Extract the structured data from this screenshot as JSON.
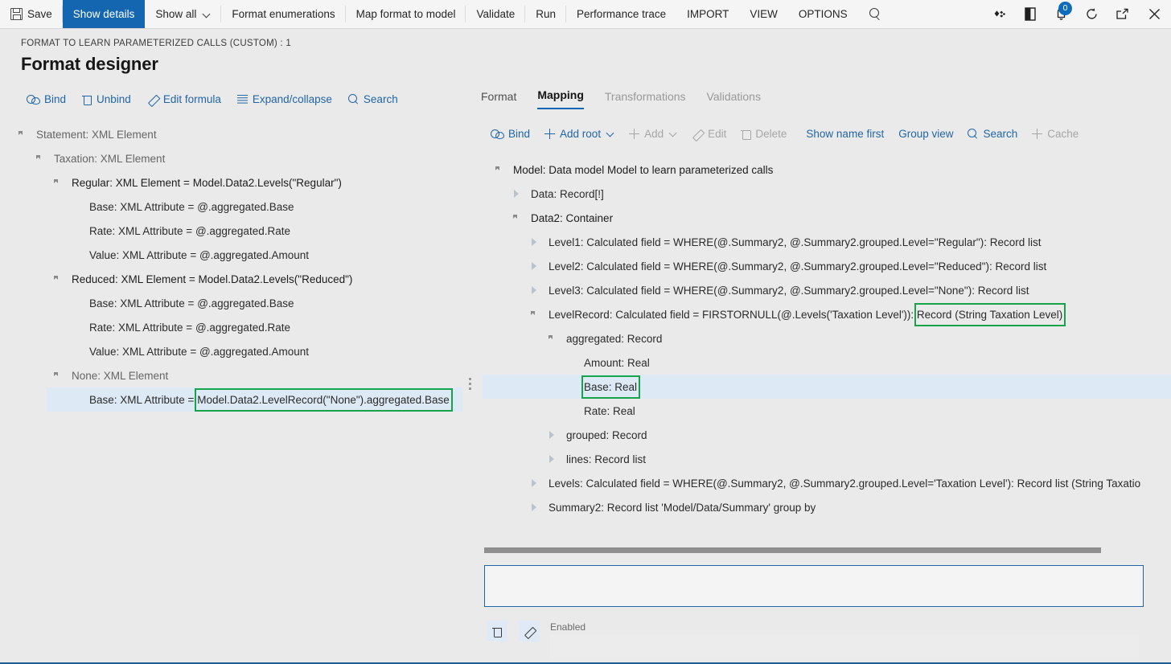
{
  "commandbar": {
    "items": [
      {
        "label": "Save",
        "icon": "save-icon",
        "state": "normal",
        "separator": true
      },
      {
        "label": "Show details",
        "icon": null,
        "state": "active",
        "separator": false
      },
      {
        "label": "Show all",
        "icon": null,
        "state": "normal",
        "caret": true,
        "separator": true
      },
      {
        "label": "Format enumerations",
        "icon": null,
        "state": "normal",
        "separator": true
      },
      {
        "label": "Map format to model",
        "icon": null,
        "state": "normal",
        "separator": true
      },
      {
        "label": "Validate",
        "icon": null,
        "state": "normal",
        "separator": true
      },
      {
        "label": "Run",
        "icon": null,
        "state": "normal",
        "separator": true
      },
      {
        "label": "Performance trace",
        "icon": null,
        "state": "normal",
        "separator": false
      },
      {
        "label": "IMPORT",
        "icon": null,
        "state": "normal",
        "separator": false
      },
      {
        "label": "VIEW",
        "icon": null,
        "state": "normal",
        "separator": false
      },
      {
        "label": "OPTIONS",
        "icon": null,
        "state": "normal",
        "separator": false
      }
    ],
    "search_icon": "search-icon",
    "right_icons": [
      {
        "name": "diamond-settings-icon",
        "glyph": "❖"
      },
      {
        "name": "office-app-icon",
        "glyph": "◗"
      },
      {
        "name": "notifications-icon",
        "glyph": "◖",
        "badge": "0"
      },
      {
        "name": "refresh-icon",
        "glyph": "↻"
      },
      {
        "name": "popout-icon",
        "glyph": "↗"
      },
      {
        "name": "close-icon",
        "glyph": "✕"
      }
    ]
  },
  "header": {
    "breadcrumb": "FORMAT TO LEARN PARAMETERIZED CALLS (CUSTOM) : 1",
    "title": "Format designer"
  },
  "format_toolbar": {
    "items": [
      {
        "label": "Bind",
        "icon": "bind-icon",
        "disabled": false
      },
      {
        "label": "Unbind",
        "icon": "trash-icon",
        "disabled": false
      },
      {
        "label": "Edit formula",
        "icon": "pencil-icon",
        "disabled": false
      },
      {
        "label": "Expand/collapse",
        "icon": "lines-icon",
        "disabled": false
      },
      {
        "label": "Search",
        "icon": "search-icon",
        "disabled": false
      }
    ]
  },
  "tabs": [
    {
      "label": "Format",
      "selected": false,
      "muted": false
    },
    {
      "label": "Mapping",
      "selected": true,
      "muted": false
    },
    {
      "label": "Transformations",
      "selected": false,
      "muted": true
    },
    {
      "label": "Validations",
      "selected": false,
      "muted": true
    }
  ],
  "mapping_toolbar": {
    "items": [
      {
        "label": "Bind",
        "icon": "bind-icon",
        "disabled": false,
        "caret": false
      },
      {
        "label": "Add root",
        "icon": "plus-icon",
        "disabled": false,
        "caret": true
      },
      {
        "label": "Add",
        "icon": "plus-icon",
        "disabled": true,
        "caret": true
      },
      {
        "label": "Edit",
        "icon": "pencil-icon",
        "disabled": true,
        "caret": false
      },
      {
        "label": "Delete",
        "icon": "trash-icon",
        "disabled": true,
        "caret": false
      },
      {
        "label": "Show name first",
        "icon": null,
        "disabled": false,
        "caret": false
      },
      {
        "label": "Group view",
        "icon": null,
        "disabled": false,
        "caret": false
      },
      {
        "label": "Search",
        "icon": "search-icon",
        "disabled": false,
        "caret": false
      },
      {
        "label": "Cache",
        "icon": "plus-icon",
        "disabled": true,
        "caret": false
      }
    ]
  },
  "format_tree": [
    {
      "text": "Statement: XML Element",
      "depth": 0,
      "twisty": "expanded",
      "tone": "dim",
      "selected": false,
      "highlight": null
    },
    {
      "text": "Taxation: XML Element",
      "depth": 1,
      "twisty": "expanded",
      "tone": "dim",
      "selected": false,
      "highlight": null
    },
    {
      "text": "Regular: XML Element = Model.Data2.Levels(\"Regular\")",
      "depth": 2,
      "twisty": "expanded",
      "tone": "strong",
      "selected": false,
      "highlight": null
    },
    {
      "text": "Base: XML Attribute = @.aggregated.Base",
      "depth": 3,
      "twisty": "none",
      "tone": "norm",
      "selected": false,
      "highlight": null
    },
    {
      "text": "Rate: XML Attribute = @.aggregated.Rate",
      "depth": 3,
      "twisty": "none",
      "tone": "norm",
      "selected": false,
      "highlight": null
    },
    {
      "text": "Value: XML Attribute = @.aggregated.Amount",
      "depth": 3,
      "twisty": "none",
      "tone": "norm",
      "selected": false,
      "highlight": null
    },
    {
      "text": "Reduced: XML Element = Model.Data2.Levels(\"Reduced\")",
      "depth": 2,
      "twisty": "expanded",
      "tone": "strong",
      "selected": false,
      "highlight": null
    },
    {
      "text": "Base: XML Attribute = @.aggregated.Base",
      "depth": 3,
      "twisty": "none",
      "tone": "norm",
      "selected": false,
      "highlight": null
    },
    {
      "text": "Rate: XML Attribute = @.aggregated.Rate",
      "depth": 3,
      "twisty": "none",
      "tone": "norm",
      "selected": false,
      "highlight": null
    },
    {
      "text": "Value: XML Attribute = @.aggregated.Amount",
      "depth": 3,
      "twisty": "none",
      "tone": "norm",
      "selected": false,
      "highlight": null
    },
    {
      "text": "None: XML Element",
      "depth": 2,
      "twisty": "expanded",
      "tone": "dim",
      "selected": false,
      "highlight": null
    },
    {
      "text": "Base: XML Attribute = Model.Data2.LevelRecord(\"None\").aggregated.Base",
      "depth": 3,
      "twisty": "none",
      "tone": "norm",
      "selected": true,
      "highlight": "Model.Data2.LevelRecord(\"None\").aggregated.Base"
    }
  ],
  "mapping_tree": [
    {
      "text": "Model: Data model Model to learn parameterized calls",
      "depth": 0,
      "twisty": "expanded",
      "tone": "strong",
      "selected": false,
      "highlight": null
    },
    {
      "text": "Data: Record[!]",
      "depth": 1,
      "twisty": "collapsed",
      "tone": "norm",
      "selected": false,
      "highlight": null
    },
    {
      "text": "Data2: Container",
      "depth": 1,
      "twisty": "expanded",
      "tone": "strong",
      "selected": false,
      "highlight": null
    },
    {
      "text": "Level1: Calculated field = WHERE(@.Summary2, @.Summary2.grouped.Level=\"Regular\"): Record list",
      "depth": 2,
      "twisty": "collapsed",
      "tone": "norm",
      "selected": false,
      "highlight": null
    },
    {
      "text": "Level2: Calculated field = WHERE(@.Summary2, @.Summary2.grouped.Level=\"Reduced\"): Record list",
      "depth": 2,
      "twisty": "collapsed",
      "tone": "norm",
      "selected": false,
      "highlight": null
    },
    {
      "text": "Level3: Calculated field = WHERE(@.Summary2, @.Summary2.grouped.Level=\"None\"): Record list",
      "depth": 2,
      "twisty": "collapsed",
      "tone": "norm",
      "selected": false,
      "highlight": null
    },
    {
      "text": "LevelRecord: Calculated field = FIRSTORNULL(@.Levels('Taxation Level')): Record (String Taxation Level)",
      "depth": 2,
      "twisty": "expanded",
      "tone": "norm",
      "selected": false,
      "highlight": "Record (String Taxation Level)"
    },
    {
      "text": "aggregated: Record",
      "depth": 3,
      "twisty": "expanded",
      "tone": "norm",
      "selected": false,
      "highlight": null
    },
    {
      "text": "Amount: Real",
      "depth": 4,
      "twisty": "none",
      "tone": "norm",
      "selected": false,
      "highlight": null
    },
    {
      "text": "Base: Real",
      "depth": 4,
      "twisty": "none",
      "tone": "norm",
      "selected": true,
      "highlight": "Base: Real"
    },
    {
      "text": "Rate: Real",
      "depth": 4,
      "twisty": "none",
      "tone": "norm",
      "selected": false,
      "highlight": null
    },
    {
      "text": "grouped: Record",
      "depth": 3,
      "twisty": "collapsed",
      "tone": "norm",
      "selected": false,
      "highlight": null
    },
    {
      "text": "lines: Record list",
      "depth": 3,
      "twisty": "collapsed",
      "tone": "norm",
      "selected": false,
      "highlight": null
    },
    {
      "text": "Levels: Calculated field = WHERE(@.Summary2, @.Summary2.grouped.Level='Taxation Level'): Record list (String Taxatio",
      "depth": 2,
      "twisty": "collapsed",
      "tone": "norm",
      "selected": false,
      "highlight": null
    },
    {
      "text": "Summary2: Record list 'Model/Data/Summary' group by",
      "depth": 2,
      "twisty": "collapsed",
      "tone": "norm",
      "selected": false,
      "highlight": null
    }
  ],
  "editor": {
    "formula_value": "",
    "formula_placeholder": "",
    "enabled_label": "Enabled",
    "enabled_value": "",
    "delete_icon": "trash-icon",
    "edit_icon": "pencil-icon"
  },
  "colors": {
    "accent": "#1566b0",
    "link": "#2266a8",
    "selection": "#dde9f5",
    "annotation": "#16a34a",
    "chrome": "#f5f5f5",
    "page_bg": "#eaeaea"
  }
}
